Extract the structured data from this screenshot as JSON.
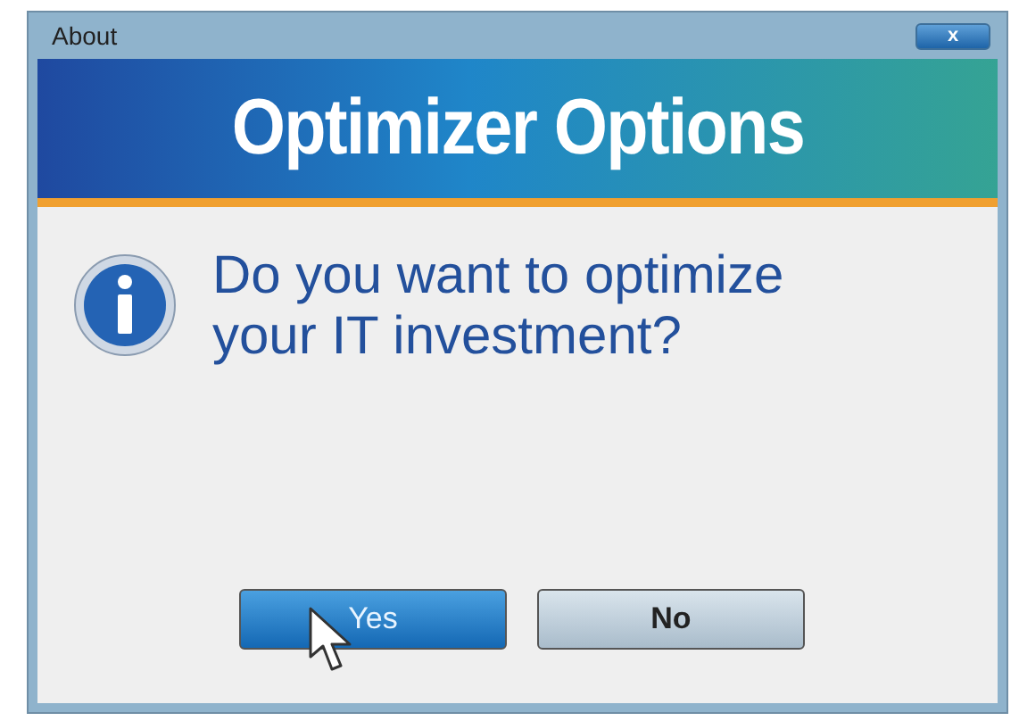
{
  "window": {
    "title": "About",
    "close_label": "x"
  },
  "banner": {
    "title": "Optimizer Options"
  },
  "message": "Do you want to optimize your IT investment?",
  "buttons": [
    {
      "label": "Yes",
      "selected": true
    },
    {
      "label": "No",
      "selected": false
    }
  ]
}
